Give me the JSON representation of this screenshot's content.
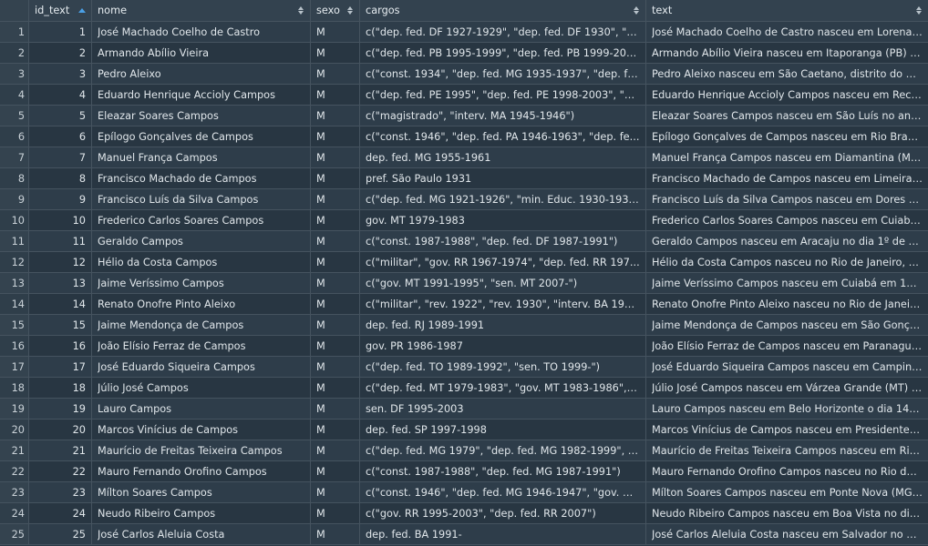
{
  "columns": [
    {
      "key": "rownum",
      "label": ""
    },
    {
      "key": "id_text",
      "label": "id_text",
      "sort": "asc"
    },
    {
      "key": "nome",
      "label": "nome",
      "sort": "none"
    },
    {
      "key": "sexo",
      "label": "sexo",
      "sort": "none"
    },
    {
      "key": "cargos",
      "label": "cargos",
      "sort": "none"
    },
    {
      "key": "text",
      "label": "text",
      "sort": "none"
    }
  ],
  "rows": [
    {
      "rownum": "1",
      "id_text": "1",
      "nome": "José Machado Coelho de Castro",
      "sexo": "M",
      "cargos": "c(\"dep. fed. DF 1927-1929\", \"dep. fed. DF 1930\", \"c...",
      "text": "José Machado Coelho de Castro nasceu em Lorena (..."
    },
    {
      "rownum": "2",
      "id_text": "2",
      "nome": "Armando Abílio Vieira",
      "sexo": "M",
      "cargos": "c(\"dep. fed. PB 1995-1999\", \"dep. fed. PB 1999-200...",
      "text": "Armando Abílio Vieira nasceu em Itaporanga (PB) n..."
    },
    {
      "rownum": "3",
      "id_text": "3",
      "nome": "Pedro Aleixo",
      "sexo": "M",
      "cargos": "c(\"const. 1934\", \"dep. fed. MG 1935-1937\", \"dep. fe...",
      "text": "Pedro Aleixo nasceu em São Caetano, distrito do mu..."
    },
    {
      "rownum": "4",
      "id_text": "4",
      "nome": "Eduardo Henrique Accioly Campos",
      "sexo": "M",
      "cargos": "c(\"dep. fed. PE 1995\", \"dep. fed. PE 1998-2003\", \"m...",
      "text": "Eduardo Henrique Accioly Campos nasceu em Recif..."
    },
    {
      "rownum": "5",
      "id_text": "5",
      "nome": "Eleazar Soares Campos",
      "sexo": "M",
      "cargos": "c(\"magistrado\", \"interv. MA 1945-1946\")",
      "text": "Eleazar Soares Campos nasceu em São Luís no ano ..."
    },
    {
      "rownum": "6",
      "id_text": "6",
      "nome": "Epílogo Gonçalves de Campos",
      "sexo": "M",
      "cargos": "c(\"const. 1946\", \"dep. fed. PA 1946-1963\", \"dep. fe...",
      "text": "Epílogo Gonçalves de Campos nasceu em Rio Branc..."
    },
    {
      "rownum": "7",
      "id_text": "7",
      "nome": "Manuel França Campos",
      "sexo": "M",
      "cargos": "dep. fed. MG 1955-1961",
      "text": "Manuel França Campos nasceu em Diamantina (MG..."
    },
    {
      "rownum": "8",
      "id_text": "8",
      "nome": "Francisco Machado de Campos",
      "sexo": "M",
      "cargos": "pref. São Paulo 1931",
      "text": "Francisco Machado de Campos nasceu em Limeira (..."
    },
    {
      "rownum": "9",
      "id_text": "9",
      "nome": "Francisco Luís da Silva Campos",
      "sexo": "M",
      "cargos": "c(\"dep. fed. MG 1921-1926\", \"min. Educ. 1930-1932...",
      "text": "Francisco Luís da Silva Campos nasceu em Dores do..."
    },
    {
      "rownum": "10",
      "id_text": "10",
      "nome": "Frederico Carlos Soares Campos",
      "sexo": "M",
      "cargos": "gov. MT 1979-1983",
      "text": "Frederico Carlos Soares Campos nasceu em Cuiabá ..."
    },
    {
      "rownum": "11",
      "id_text": "11",
      "nome": "Geraldo Campos",
      "sexo": "M",
      "cargos": "c(\"const. 1987-1988\", \"dep. fed. DF 1987-1991\")",
      "text": "Geraldo Campos nasceu em Aracaju no dia 1º de no..."
    },
    {
      "rownum": "12",
      "id_text": "12",
      "nome": "Hélio da Costa Campos",
      "sexo": "M",
      "cargos": "c(\"militar\", \"gov. RR 1967-1974\", \"dep. fed. RR 197...",
      "text": "Hélio da Costa Campos nasceu no Rio de Janeiro, en..."
    },
    {
      "rownum": "13",
      "id_text": "13",
      "nome": "Jaime Veríssimo Campos",
      "sexo": "M",
      "cargos": "c(\"gov. MT 1991-1995\", \"sen. MT 2007-\")",
      "text": "Jaime Veríssimo Campos nasceu em Cuiabá em 13 ..."
    },
    {
      "rownum": "14",
      "id_text": "14",
      "nome": "Renato Onofre Pinto Aleixo",
      "sexo": "M",
      "cargos": "c(\"militar\", \"rev. 1922\", \"rev. 1930\", \"interv. BA 194...",
      "text": "Renato Onofre Pinto Aleixo nasceu no Rio de Janeiro..."
    },
    {
      "rownum": "15",
      "id_text": "15",
      "nome": "Jaime Mendonça de Campos",
      "sexo": "M",
      "cargos": "dep. fed. RJ 1989-1991",
      "text": "Jaime Mendonça de Campos nasceu em São Gonçal..."
    },
    {
      "rownum": "16",
      "id_text": "16",
      "nome": "João Elísio Ferraz de Campos",
      "sexo": "M",
      "cargos": "gov. PR 1986-1987",
      "text": "João Elísio Ferraz de Campos nasceu em Paranaguá ..."
    },
    {
      "rownum": "17",
      "id_text": "17",
      "nome": "José Eduardo Siqueira Campos",
      "sexo": "M",
      "cargos": "c(\"dep. fed. TO 1989-1992\", \"sen. TO 1999-\")",
      "text": "José Eduardo Siqueira Campos nasceu em Campina..."
    },
    {
      "rownum": "18",
      "id_text": "18",
      "nome": "Júlio José Campos",
      "sexo": "M",
      "cargos": "c(\"dep. fed. MT 1979-1983\", \"gov. MT 1983-1986\", \"...",
      "text": "Júlio José Campos nasceu em Várzea Grande (MT) n..."
    },
    {
      "rownum": "19",
      "id_text": "19",
      "nome": "Lauro Campos",
      "sexo": "M",
      "cargos": "sen. DF 1995-2003",
      "text": "Lauro Campos nasceu em Belo Horizonte o dia 14 de..."
    },
    {
      "rownum": "20",
      "id_text": "20",
      "nome": "Marcos Vinícius de Campos",
      "sexo": "M",
      "cargos": "dep. fed. SP 1997-1998",
      "text": "Marcos Vinícius de Campos nasceu em Presidente V..."
    },
    {
      "rownum": "21",
      "id_text": "21",
      "nome": "Maurício de Freitas Teixeira Campos",
      "sexo": "M",
      "cargos": "c(\"dep. fed. MG 1979\", \"dep. fed. MG 1982-1999\", \"...",
      "text": "Maurício de Freitas Teixeira Campos nasceu em Rio ..."
    },
    {
      "rownum": "22",
      "id_text": "22",
      "nome": "Mauro Fernando Orofino Campos",
      "sexo": "M",
      "cargos": "c(\"const. 1987-1988\", \"dep. fed. MG 1987-1991\")",
      "text": "Mauro Fernando Orofino Campos nasceu no Rio de J..."
    },
    {
      "rownum": "23",
      "id_text": "23",
      "nome": "Mílton Soares Campos",
      "sexo": "M",
      "cargos": "c(\"const. 1946\", \"dep. fed. MG 1946-1947\", \"gov. M...",
      "text": "Mílton Soares Campos nasceu em Ponte Nova (MG) ..."
    },
    {
      "rownum": "24",
      "id_text": "24",
      "nome": "Neudo Ribeiro Campos",
      "sexo": "M",
      "cargos": "c(\"gov. RR 1995-2003\", \"dep. fed. RR 2007\")",
      "text": "Neudo Ribeiro Campos nasceu em Boa Vista no dia ..."
    },
    {
      "rownum": "25",
      "id_text": "25",
      "nome": "José Carlos Aleluia Costa",
      "sexo": "M",
      "cargos": "dep. fed. BA 1991-",
      "text": "José Carlos Aleluia Costa nasceu em Salvador no dia..."
    }
  ]
}
